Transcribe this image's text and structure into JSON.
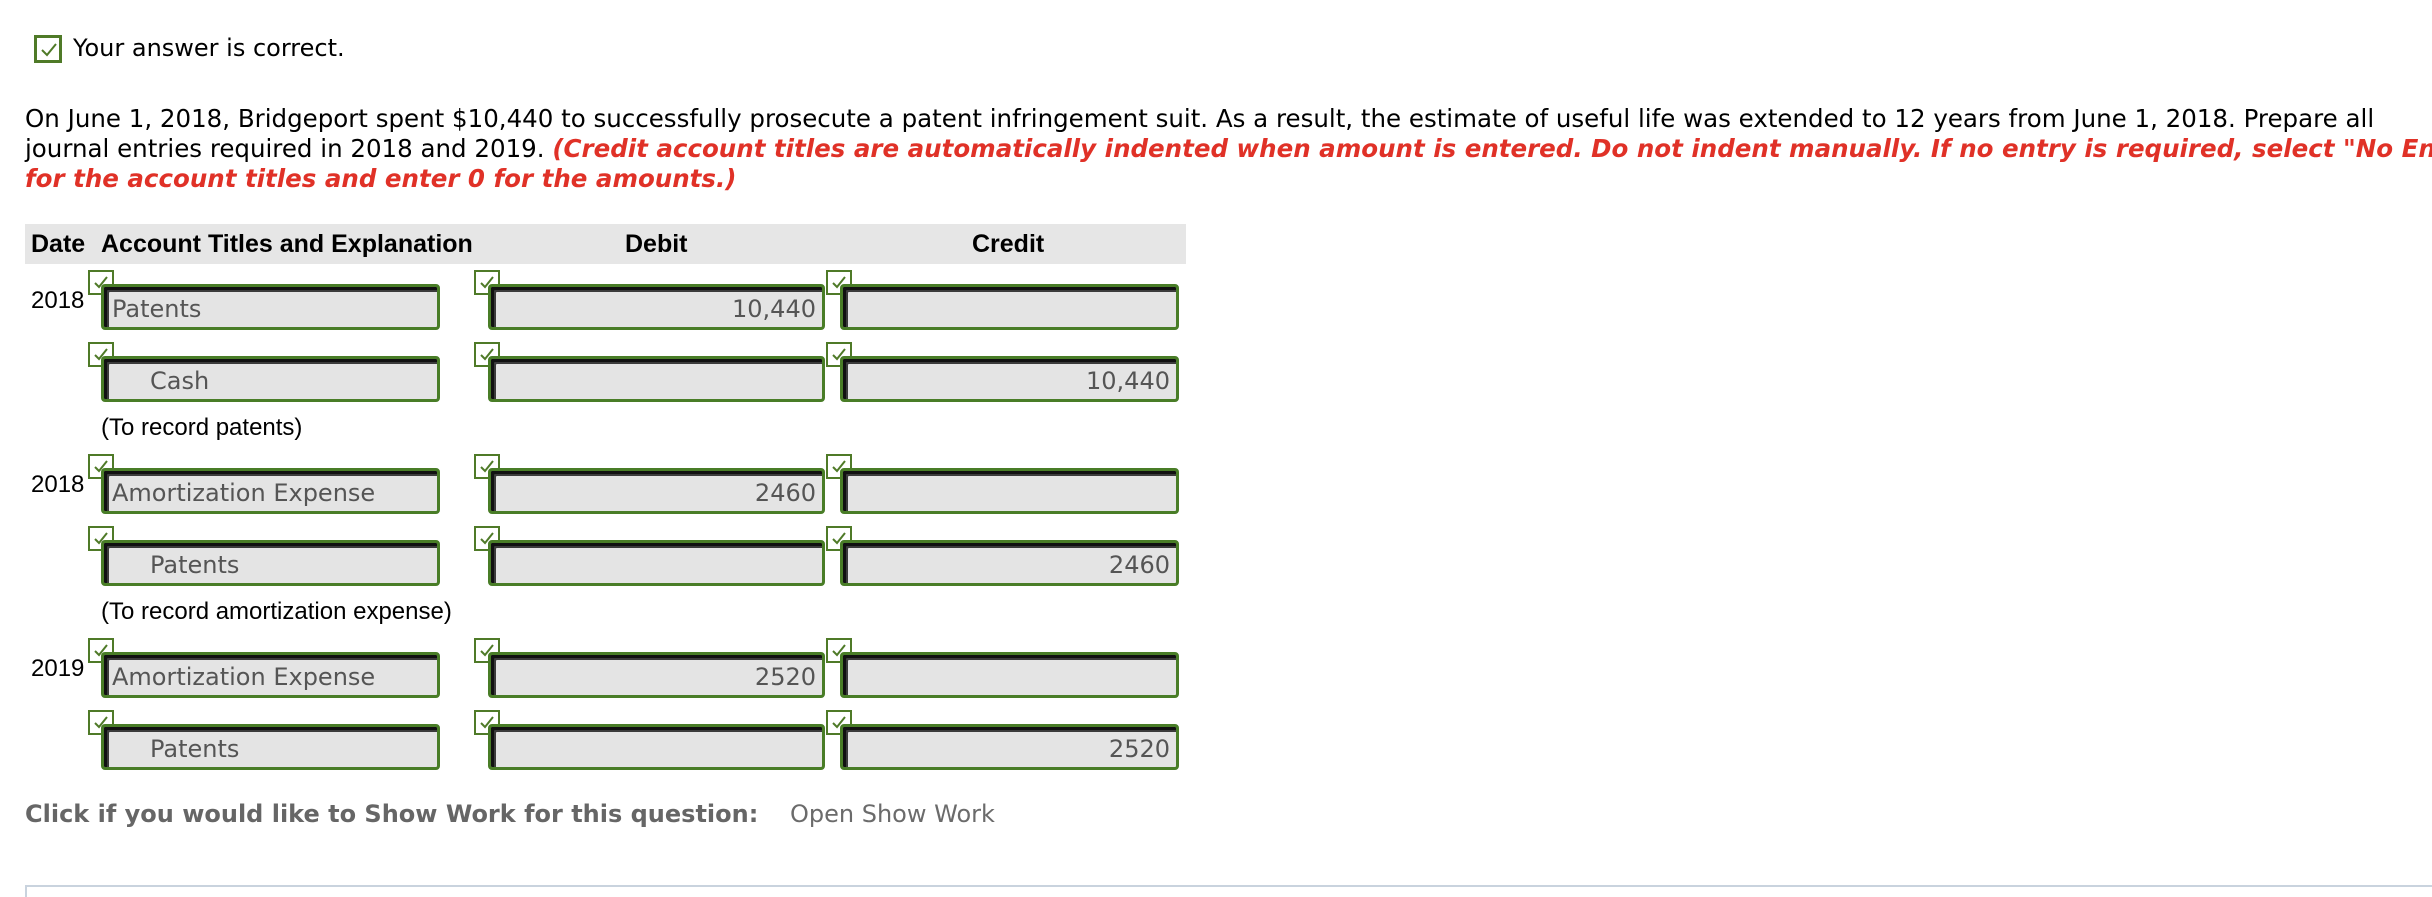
{
  "status": {
    "text": "Your answer is correct.",
    "icon": "check-icon"
  },
  "question": {
    "line1": "On June 1, 2018, Bridgeport spent $10,440 to successfully prosecute a patent infringement suit. As a result, the estimate of useful life was extended to 12 years from June 1, 2018. Prepare all",
    "line2_plain": "journal entries required in 2018 and 2019.",
    "line2_red": "(Credit account titles are automatically indented when amount is entered. Do not indent manually. If no entry is required, select \"No Entry\"",
    "line3_red": "for the account titles and enter 0 for the amounts.)"
  },
  "table": {
    "headers": {
      "date": "Date",
      "account": "Account Titles and Explanation",
      "debit": "Debit",
      "credit": "Credit"
    },
    "entries": [
      {
        "date": "2018",
        "rows": [
          {
            "account": "Patents",
            "debit": "10,440",
            "credit": ""
          },
          {
            "account": "Cash",
            "debit": "",
            "credit": "10,440"
          }
        ],
        "memo": "(To record patents)"
      },
      {
        "date": "2018",
        "rows": [
          {
            "account": "Amortization Expense",
            "debit": "2460",
            "credit": ""
          },
          {
            "account": "Patents",
            "debit": "",
            "credit": "2460"
          }
        ],
        "memo": "(To record amortization expense)"
      },
      {
        "date": "2019",
        "rows": [
          {
            "account": "Amortization Expense",
            "debit": "2520",
            "credit": ""
          },
          {
            "account": "Patents",
            "debit": "",
            "credit": "2520"
          }
        ],
        "memo": ""
      }
    ]
  },
  "show_work": {
    "label": "Click if you would like to Show Work for this question:",
    "link": "Open Show Work"
  },
  "colors": {
    "check_border": "#4f7a28",
    "field_border": "#497d27",
    "instruction_red": "#e03127",
    "header_bg": "#e6e6e6"
  }
}
